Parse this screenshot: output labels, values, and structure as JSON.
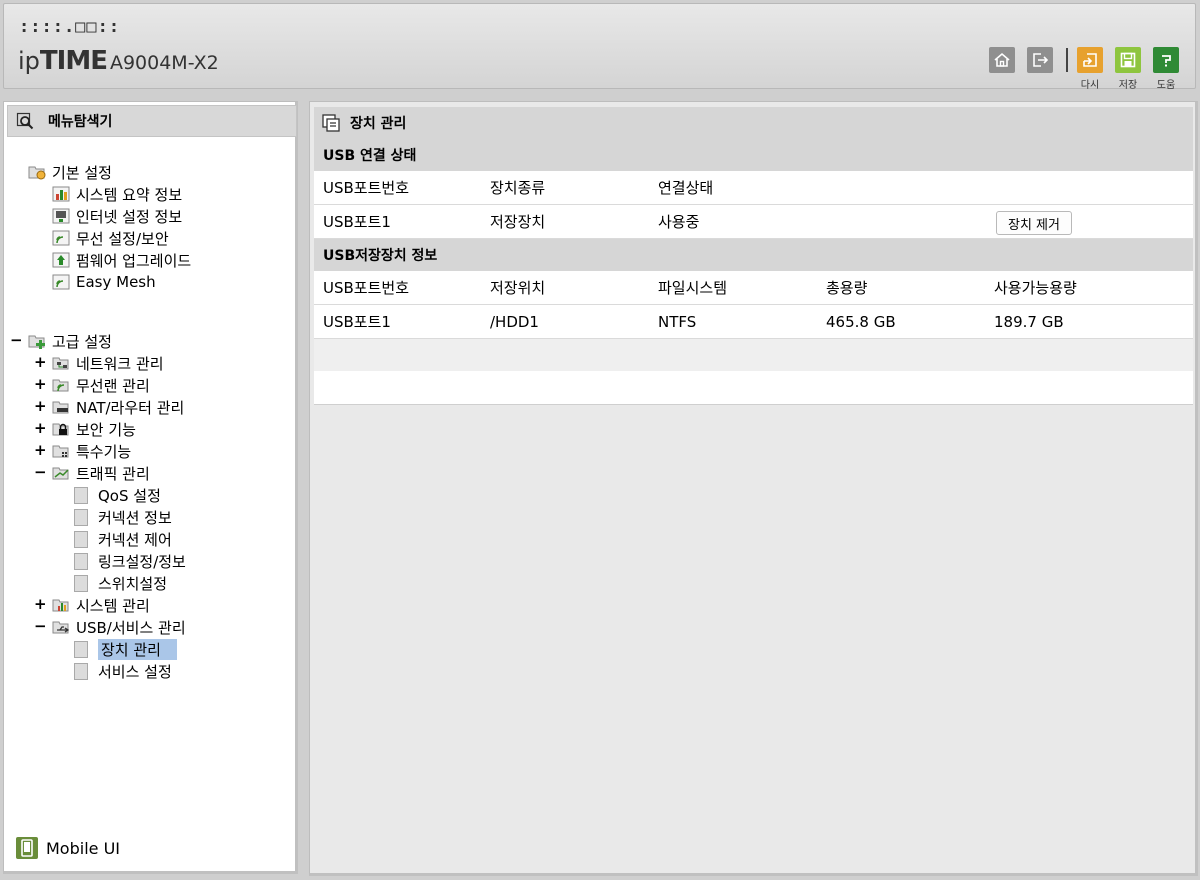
{
  "header": {
    "brand_dots": "::::.□□::",
    "logo_ip": "ip",
    "logo_time": "TIME",
    "model": "A9004M-X2",
    "buttons": {
      "reload": "다시",
      "save": "저장",
      "help": "도움"
    },
    "colors": {
      "reload": "#e7a12e",
      "save": "#8ec53e",
      "help": "#2f8a35"
    }
  },
  "sidebar": {
    "title": "메뉴탐색기",
    "basic": {
      "label": "기본 설정",
      "items": [
        "시스템 요약 정보",
        "인터넷 설정 정보",
        "무선 설정/보안",
        "펌웨어 업그레이드",
        "Easy Mesh"
      ]
    },
    "advanced": {
      "label": "고급 설정",
      "items": [
        "네트워크 관리",
        "무선랜 관리",
        "NAT/라우터 관리",
        "보안 기능",
        "특수기능",
        "트래픽 관리"
      ],
      "traffic_children": [
        "QoS 설정",
        "커넥션 정보",
        "커넥션 제어",
        "링크설정/정보",
        "스위치설정"
      ],
      "system": "시스템 관리",
      "usb": "USB/서비스 관리",
      "usb_children": [
        "장치 관리",
        "서비스 설정"
      ]
    },
    "mobile": "Mobile UI",
    "selected_color": "#aac6e8"
  },
  "main": {
    "title": "장치 관리",
    "usb_status": {
      "section": "USB 연결 상태",
      "headers": [
        "USB포트번호",
        "장치종류",
        "연결상태"
      ],
      "rows": [
        {
          "port": "USB포트1",
          "type": "저장장치",
          "status": "사용중",
          "action": "장치 제거"
        }
      ]
    },
    "storage_info": {
      "section": "USB저장장치 정보",
      "headers": [
        "USB포트번호",
        "저장위치",
        "파일시스템",
        "총용량",
        "사용가능용량"
      ],
      "rows": [
        {
          "port": "USB포트1",
          "location": "/HDD1",
          "fs": "NTFS",
          "total": "465.8 GB",
          "free": "189.7 GB"
        }
      ]
    }
  }
}
